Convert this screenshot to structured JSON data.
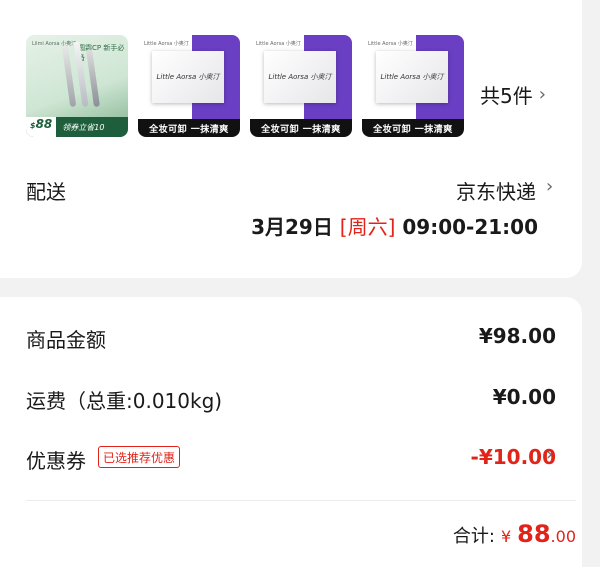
{
  "delivery_card": {
    "products": {
      "main": {
        "brand": "Lilmi Aorsa 小奥汀",
        "tag": "圆霜CP 新手必备",
        "price_symbol": "$",
        "price": "88",
        "coupon": "领券立省10"
      },
      "wipes": [
        {
          "brand": "Little Aorsa 小奥汀",
          "pack": "Little Aorsa 小奥汀",
          "banner": "全妆可卸 一抹清爽"
        },
        {
          "brand": "Little Aorsa 小奥汀",
          "pack": "Little Aorsa 小奥汀",
          "banner": "全妆可卸 一抹清爽"
        },
        {
          "brand": "Little Aorsa 小奥汀",
          "pack": "Little Aorsa 小奥汀",
          "banner": "全妆可卸 一抹清爽"
        }
      ]
    },
    "count_label": "共5件",
    "delivery_label": "配送",
    "courier": "京东快递",
    "delivery_date": "3月29日",
    "delivery_day": "[周六]",
    "delivery_window": "09:00-21:00"
  },
  "summary_card": {
    "goods_label": "商品金额",
    "goods_value": "¥98.00",
    "shipping_label": "运费（总重:0.010kg)",
    "shipping_value": "¥0.00",
    "coupon_label": "优惠券",
    "coupon_badge": "已选推荐优惠",
    "coupon_value": "-¥10.00",
    "total_label": "合计:",
    "total_currency": "¥",
    "total_integer": "88",
    "total_decimal": ".00"
  },
  "icons": {
    "chevron": "chevron-right-icon"
  },
  "colors": {
    "accent_red": "#e2231a",
    "wipe_purple": "#6a3fc4",
    "product_green": "#1f5e3c"
  }
}
